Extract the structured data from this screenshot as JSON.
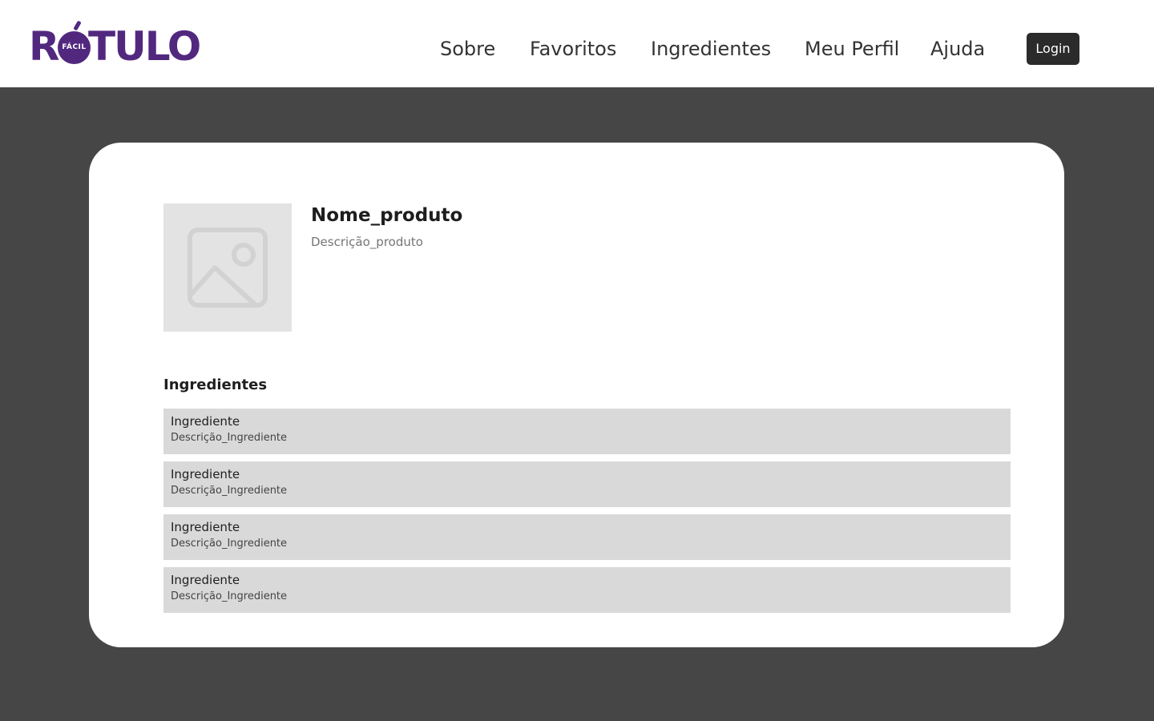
{
  "header": {
    "logo": {
      "first_letter": "R",
      "circle_text": "FÁCIL",
      "rest": "TULO",
      "color": "#52287f"
    },
    "nav": [
      "Sobre",
      "Favoritos",
      "Ingredientes",
      "Meu Perfil",
      "Ajuda"
    ],
    "login_label": "Login"
  },
  "product": {
    "name": "Nome_produto",
    "description": "Descrição_produto",
    "image_icon": "image-placeholder-icon"
  },
  "ingredients": {
    "title": "Ingredientes",
    "items": [
      {
        "name": "Ingrediente",
        "description": "Descrição_Ingrediente"
      },
      {
        "name": "Ingrediente",
        "description": "Descrição_Ingrediente"
      },
      {
        "name": "Ingrediente",
        "description": "Descrição_Ingrediente"
      },
      {
        "name": "Ingrediente",
        "description": "Descrição_Ingrediente"
      }
    ]
  },
  "colors": {
    "brand": "#52287f",
    "background": "#464646",
    "card": "#ffffff",
    "ingredient_row": "#d9d9d9",
    "login_button": "#2b2b2b"
  }
}
